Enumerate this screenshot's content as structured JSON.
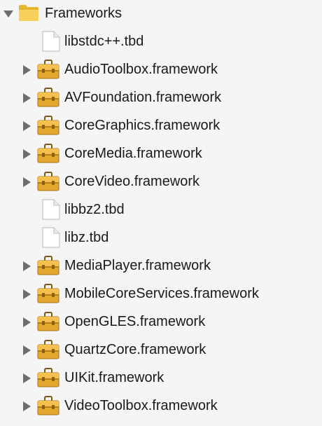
{
  "tree": {
    "root": {
      "label": "Frameworks",
      "icon": "folder-icon",
      "expanded": true
    },
    "items": [
      {
        "label": "libstdc++.tbd",
        "icon": "file-icon",
        "expandable": false
      },
      {
        "label": "AudioToolbox.framework",
        "icon": "toolbox-icon",
        "expandable": true
      },
      {
        "label": "AVFoundation.framework",
        "icon": "toolbox-icon",
        "expandable": true
      },
      {
        "label": "CoreGraphics.framework",
        "icon": "toolbox-icon",
        "expandable": true
      },
      {
        "label": "CoreMedia.framework",
        "icon": "toolbox-icon",
        "expandable": true
      },
      {
        "label": "CoreVideo.framework",
        "icon": "toolbox-icon",
        "expandable": true
      },
      {
        "label": "libbz2.tbd",
        "icon": "file-icon",
        "expandable": false
      },
      {
        "label": "libz.tbd",
        "icon": "file-icon",
        "expandable": false
      },
      {
        "label": "MediaPlayer.framework",
        "icon": "toolbox-icon",
        "expandable": true
      },
      {
        "label": "MobileCoreServices.framework",
        "icon": "toolbox-icon",
        "expandable": true
      },
      {
        "label": "OpenGLES.framework",
        "icon": "toolbox-icon",
        "expandable": true
      },
      {
        "label": "QuartzCore.framework",
        "icon": "toolbox-icon",
        "expandable": true
      },
      {
        "label": "UIKit.framework",
        "icon": "toolbox-icon",
        "expandable": true
      },
      {
        "label": "VideoToolbox.framework",
        "icon": "toolbox-icon",
        "expandable": true
      }
    ]
  },
  "colors": {
    "background": "#f5f5f5",
    "text": "#1a1a1a",
    "disclosure": "#6e6e6e",
    "folder": "#f2c94c",
    "toolbox": "#e3a92f"
  }
}
